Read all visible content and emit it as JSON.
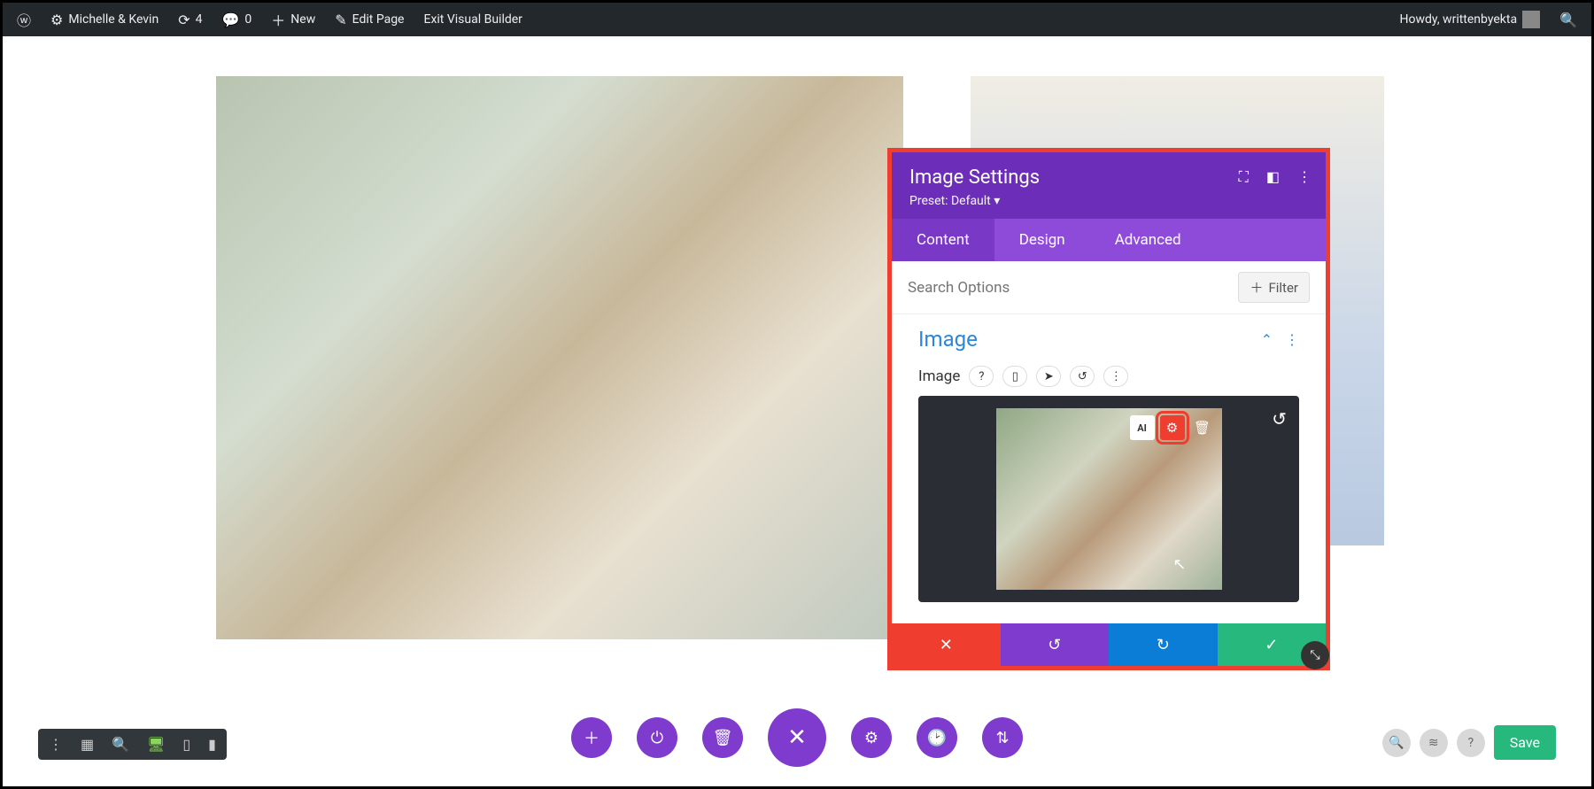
{
  "wpbar": {
    "site_name": "Michelle & Kevin",
    "updates_count": "4",
    "comments_count": "0",
    "new_label": "New",
    "edit_page_label": "Edit Page",
    "exit_vb_label": "Exit Visual Builder",
    "howdy": "Howdy, writtenbyekta"
  },
  "modal": {
    "title": "Image Settings",
    "preset": "Preset: Default",
    "tabs": {
      "content": "Content",
      "design": "Design",
      "advanced": "Advanced"
    },
    "search_placeholder": "Search Options",
    "filter_label": "Filter",
    "section_title": "Image",
    "field_label": "Image"
  },
  "footer": {
    "save": "Save"
  },
  "colors": {
    "accent": "#7e3bce",
    "danger": "#ef3e2f",
    "primary": "#0b7dd6",
    "success": "#26b87c"
  }
}
